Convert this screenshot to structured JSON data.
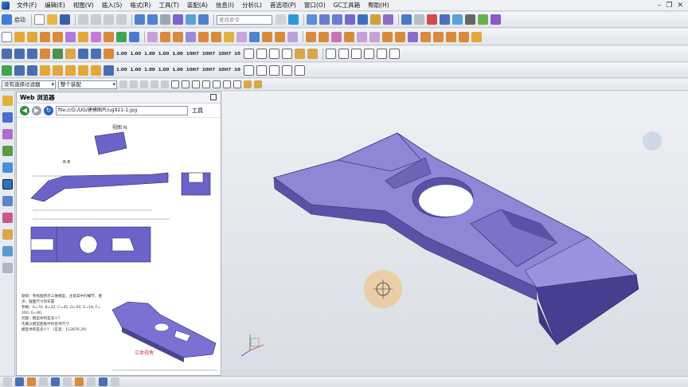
{
  "menubar": {
    "items": [
      "文件(F)",
      "编辑(E)",
      "视图(V)",
      "插入(S)",
      "格式(R)",
      "工具(T)",
      "装配(A)",
      "信息(I)",
      "分析(L)",
      "首选项(P)",
      "窗口(O)",
      "GC工具箱",
      "帮助(H)"
    ]
  },
  "toolbar1": {
    "start_label": "启动",
    "search_placeholder": "查找命令"
  },
  "toolbar3": {
    "labels": [
      "1.00",
      "1.00",
      "1.00",
      "1.00",
      "1.00",
      "10H7",
      "10H7",
      "10H7",
      "10"
    ]
  },
  "filterbar": {
    "filter_value": "没有选择过滤器",
    "scope_value": "整个装配"
  },
  "panel": {
    "title": "Web 浏览器",
    "url": "file:///D:/UG/建模图片/ug921-1.jpg",
    "tools_label": "工具",
    "doc": {
      "view_label": "视图 N",
      "section_label": "B-B",
      "caption_label": "立体视角",
      "notes": [
        "题目：参照图所示三维模型，注意其中的细节，重",
        "点：截面尺寸的布置",
        "参数：A=70, B=32, C=45, D=50, E=18, F=",
        "200, G=80",
        "问题：模型体积是多少？",
        "先确认模型图纸中的各项尺寸",
        "模型体积是多少？（答案：112876.29）"
      ]
    }
  },
  "colors": {
    "model_face": "#8f86d6",
    "model_side": "#5b52a8",
    "model_dark": "#3e3780",
    "accent_orange": "#f0c27a",
    "viewport_bg": "#e4e7ec"
  }
}
